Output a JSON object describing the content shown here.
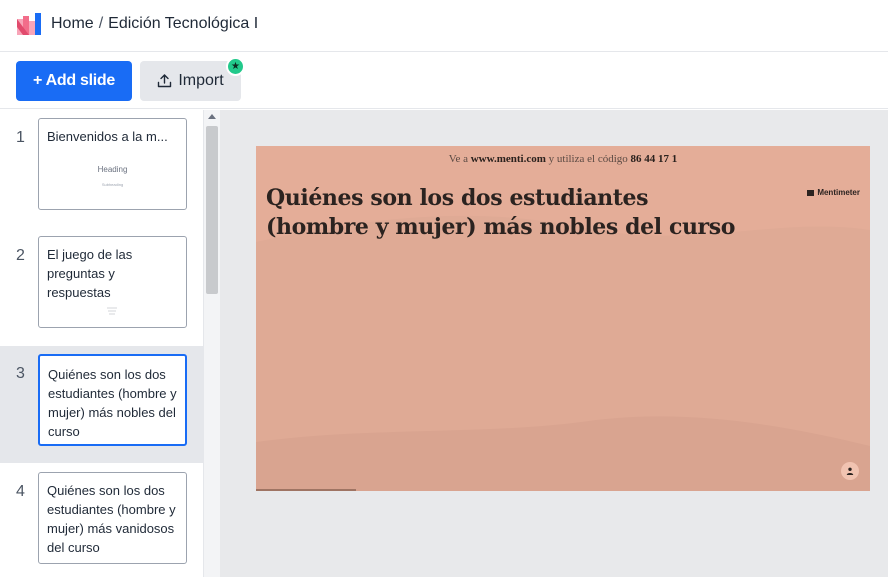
{
  "header": {
    "logo_icon": "mentimeter-logo-icon",
    "breadcrumb": {
      "home": "Home",
      "separator": "/",
      "current": "Edición Tecnológica I"
    }
  },
  "toolbar": {
    "add_slide_label": "+ Add slide",
    "import_label": "Import",
    "import_icon": "upload-icon",
    "badge_icon": "star-icon"
  },
  "slides": [
    {
      "number": "1",
      "title": "Bienvenidos a la m...",
      "mini_heading": "Heading",
      "mini_sub": "Subheading"
    },
    {
      "number": "2",
      "title": "El juego de las preguntas y respuestas"
    },
    {
      "number": "3",
      "title": "Quiénes son los dos estudiantes (hombre y mujer) más nobles del curso",
      "selected": true
    },
    {
      "number": "4",
      "title": "Quiénes son los dos estudiantes (hombre y mujer) más vanidosos del curso"
    }
  ],
  "preview": {
    "join_prefix": "Ve a",
    "join_url": "www.menti.com",
    "join_middle": "y utiliza el código",
    "join_code": "86 44 17 1",
    "question": "Quiénes son los dos estudiantes (hombre y mujer) más nobles del curso",
    "brand": "Mentimeter",
    "background_color": "#e4ad98",
    "avatar_icon": "person-icon"
  },
  "colors": {
    "accent": "#196cf5",
    "badge": "#22c98b"
  }
}
